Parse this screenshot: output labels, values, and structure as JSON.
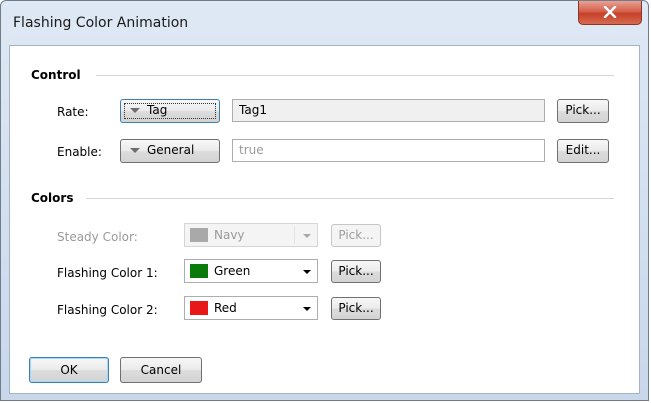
{
  "window": {
    "title": "Flashing Color Animation"
  },
  "control": {
    "section_title": "Control",
    "rate": {
      "label": "Rate:",
      "mode": "Tag",
      "value": "Tag1",
      "action": "Pick..."
    },
    "enable": {
      "label": "Enable:",
      "mode": "General",
      "value": "true",
      "action": "Edit..."
    }
  },
  "colors": {
    "section_title": "Colors",
    "steady": {
      "label": "Steady Color:",
      "name": "Navy",
      "swatch": "#a9a9a9",
      "action": "Pick...",
      "enabled": false
    },
    "flash1": {
      "label": "Flashing Color 1:",
      "name": "Green",
      "swatch": "#0a7a0a",
      "action": "Pick..."
    },
    "flash2": {
      "label": "Flashing Color 2:",
      "name": "Red",
      "swatch": "#e81818",
      "action": "Pick..."
    }
  },
  "footer": {
    "ok": "OK",
    "cancel": "Cancel"
  }
}
